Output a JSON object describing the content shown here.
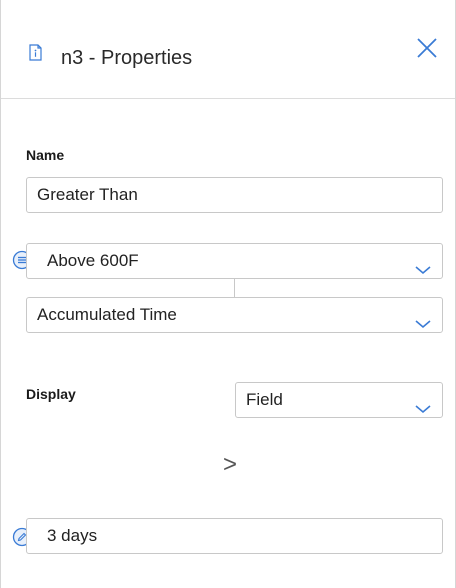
{
  "header": {
    "title": "n3 - Properties",
    "icon": "info-document-icon",
    "close_icon": "close-icon"
  },
  "name_section": {
    "label": "Name",
    "value": "Greater Than"
  },
  "source_select": {
    "value": "Above 600F",
    "icon": "list-circle-icon"
  },
  "measure_select": {
    "value": "Accumulated Time"
  },
  "display": {
    "label": "Display",
    "value": "Field"
  },
  "operator": {
    "symbol": ">"
  },
  "threshold": {
    "value": "3 days",
    "icon": "edit-pencil-icon"
  },
  "colors": {
    "accent_blue": "#3a7bd5",
    "border": "#c8c8c8"
  }
}
